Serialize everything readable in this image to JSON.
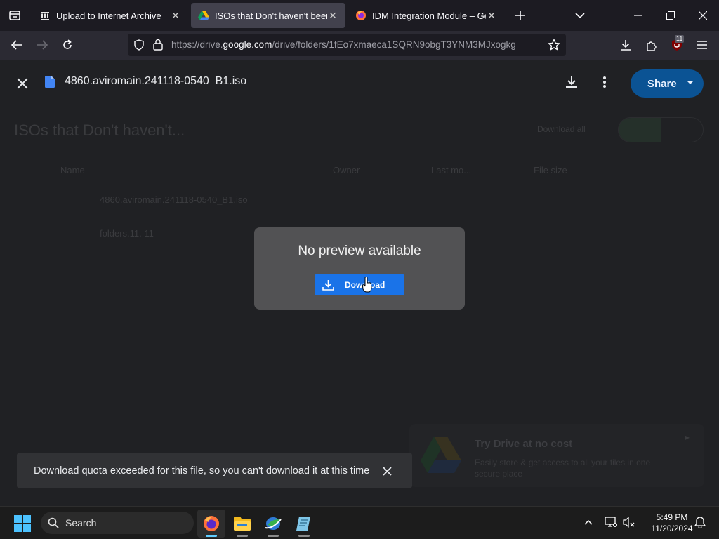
{
  "browser": {
    "tabs": [
      {
        "title": "Upload to Internet Archive",
        "active": false
      },
      {
        "title": "ISOs that Don't haven't been up",
        "active": true
      },
      {
        "title": "IDM Integration Module – Get t",
        "active": false
      }
    ],
    "url_prefix": "https://drive.",
    "url_domain": "google.com",
    "url_path": "/drive/folders/1fEo7xmaeca1SQRN9obgT3YNM3MJxogkg",
    "extension_badge": "11"
  },
  "viewer": {
    "file_name": "4860.aviromain.241118-0540_B1.iso",
    "share_label": "Share"
  },
  "background_page": {
    "folder_title": "ISOs that Don't haven't...",
    "ghost_button": "Download all",
    "columns": [
      "Name",
      "Owner",
      "Last mo...",
      "File size"
    ],
    "rows": [
      {
        "name": "4860.aviromain.241118-0540_B1.iso"
      },
      {
        "name": "folders.11. 11"
      }
    ]
  },
  "dialog": {
    "message": "No preview available",
    "download_label": "Download"
  },
  "promo": {
    "title": "Try Drive at no cost",
    "text": "Easily store & get access to all your files in one secure place",
    "close": "▸"
  },
  "snackbar": {
    "message": "Download quota exceeded for this file, so you can't download it at this time"
  },
  "taskbar": {
    "search_placeholder": "Search",
    "time": "5:49 PM",
    "date": "11/20/2024"
  },
  "colors": {
    "accent_blue": "#1a73e8",
    "share_blue": "#0b5394",
    "firefox_tab_active": "#42414d"
  }
}
